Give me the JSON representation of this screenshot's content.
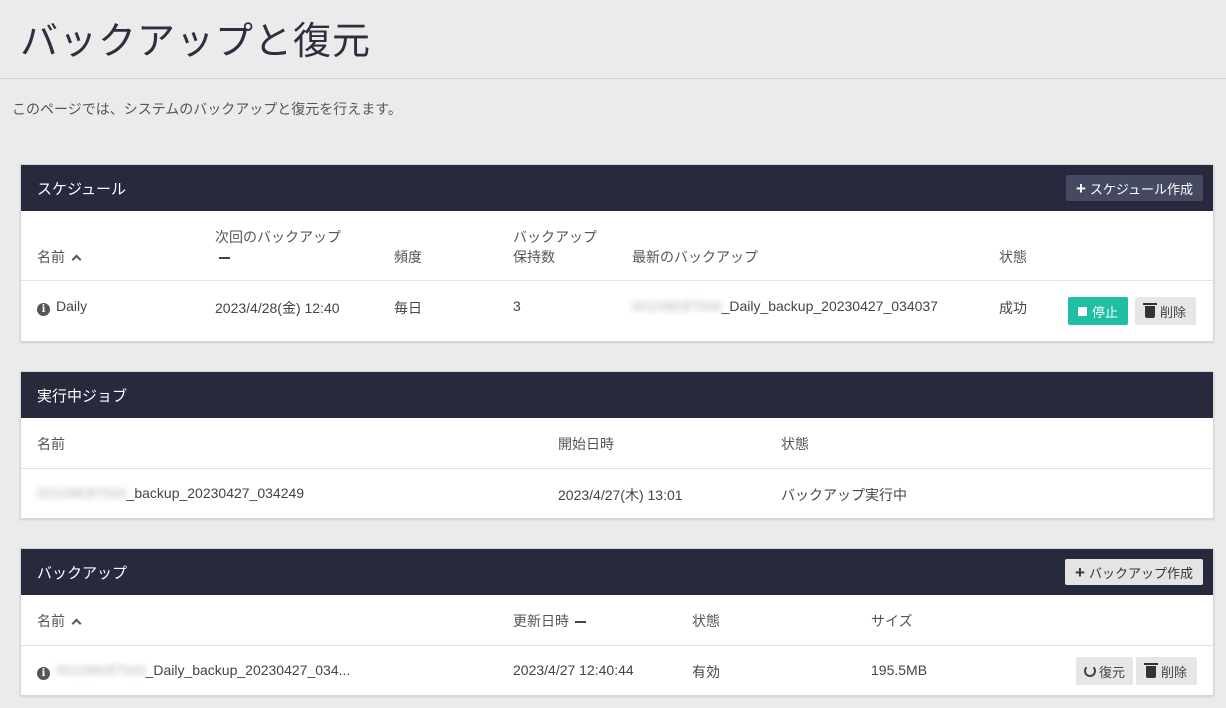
{
  "page": {
    "title": "バックアップと復元",
    "description": "このページでは、システムのバックアップと復元を行えます。"
  },
  "schedule": {
    "title": "スケジュール",
    "create_button": "スケジュール作成",
    "columns": {
      "name": "名前",
      "next_backup_line1": "次回のバックアップ",
      "frequency": "頻度",
      "retention_line1": "バックアップ",
      "retention_line2": "保持数",
      "latest_backup": "最新のバックアップ",
      "status": "状態"
    },
    "rows": [
      {
        "name": "Daily",
        "next_backup": "2023/4/28(金) 12:40",
        "frequency": "毎日",
        "retention": "3",
        "latest_backup_prefix": "0010983f7500",
        "latest_backup_suffix": "_Daily_backup_20230427_034037",
        "status": "成功",
        "stop_button": "停止",
        "delete_button": "削除"
      }
    ]
  },
  "jobs": {
    "title": "実行中ジョブ",
    "columns": {
      "name": "名前",
      "start": "開始日時",
      "status": "状態"
    },
    "rows": [
      {
        "name_prefix": "0010983f7500",
        "name_suffix": "_backup_20230427_034249",
        "start": "2023/4/27(木) 13:01",
        "status": "バックアップ実行中"
      }
    ]
  },
  "backups": {
    "title": "バックアップ",
    "create_button": "バックアップ作成",
    "columns": {
      "name": "名前",
      "updated": "更新日時",
      "status": "状態",
      "size": "サイズ"
    },
    "rows": [
      {
        "name_prefix": "0010983f7500",
        "name_suffix": "_Daily_backup_20230427_034...",
        "updated": "2023/4/27 12:40:44",
        "status": "有効",
        "size": "195.5MB",
        "restore_button": "復元",
        "delete_button": "削除"
      }
    ]
  },
  "colors": {
    "header_bg": "#262a3c",
    "accent_green": "#1fbfa4",
    "page_bg": "#ebebeb"
  }
}
